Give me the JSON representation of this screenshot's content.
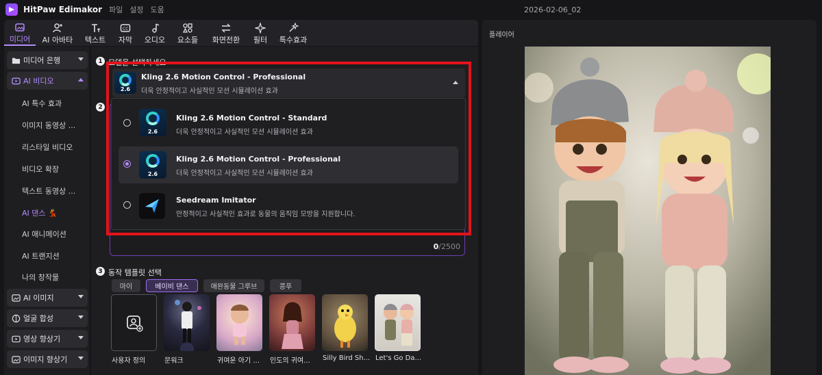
{
  "app": {
    "name": "HitPaw Edimakor",
    "project_title": "2026-02-06_02"
  },
  "menu": [
    "파일",
    "설정",
    "도움"
  ],
  "toolbar": [
    {
      "label": "미디어",
      "icon": "media-icon",
      "active": true
    },
    {
      "label": "AI 아바타",
      "icon": "ai-avatar-icon"
    },
    {
      "label": "텍스트",
      "icon": "text-icon"
    },
    {
      "label": "자막",
      "icon": "subtitle-icon"
    },
    {
      "label": "오디오",
      "icon": "audio-icon"
    },
    {
      "label": "요소들",
      "icon": "elements-icon"
    },
    {
      "label": "화면전환",
      "icon": "transition-icon"
    },
    {
      "label": "필터",
      "icon": "filter-icon"
    },
    {
      "label": "특수효과",
      "icon": "effects-icon"
    }
  ],
  "sidebar": {
    "groups": {
      "media_bank": "미디어 은행",
      "ai_video": "AI 비디오",
      "ai_image": "AI  이미지",
      "face_swap": "얼굴 합성",
      "video_enhancer": "영상 향상기",
      "image_enhancer": "이미지 향상기"
    },
    "ai_video_items": [
      "AI 특수 효과",
      "이미지 동영상 ...",
      "리스타일 비디오",
      "비디오 확장",
      "텍스트 동영상 ...",
      "AI 댄스 💃",
      "AI 애니메이션",
      "AI 트랜지션",
      "나의 창작물"
    ]
  },
  "steps": {
    "step1": {
      "num": "1",
      "label": "모델을 선택하세요"
    },
    "step2": {
      "num": "2"
    },
    "step3": {
      "num": "3",
      "label": "동작 템플릿 선택"
    }
  },
  "model_select": {
    "selected_title": "Kling 2.6 Motion Control - Professional",
    "selected_desc": "더욱 안정적이고 사실적인 모션 시뮬레이션 효과",
    "options": [
      {
        "title": "Kling 2.6 Motion Control - Standard",
        "desc": "더욱 안정적이고 사실적인 모션 시뮬레이션 효과",
        "selected": false
      },
      {
        "title": "Kling 2.6 Motion Control - Professional",
        "desc": "더욱 안정적이고 사실적인 모션 시뮬레이션 효과",
        "selected": true
      },
      {
        "title": "Seedream Imitator",
        "desc": "안정적이고 사실적인 효과로 동물의 움직임 모방을 지원합니다.",
        "selected": false
      }
    ],
    "version_badge": "2.6"
  },
  "prompt": {
    "count": "0",
    "max": "/2500"
  },
  "template_tabs": [
    {
      "label": "마이",
      "active": false
    },
    {
      "label": "베이비 댄스",
      "active": true
    },
    {
      "label": "애완동물 그루브",
      "active": false
    },
    {
      "label": "콩푸",
      "active": false
    }
  ],
  "templates": [
    "사용자 정의",
    "문워크",
    "귀여운 아기 ...",
    "인도의 귀여...",
    "Silly Bird Sh...",
    "Let's Go Da..."
  ],
  "player": {
    "title": "플레이어"
  },
  "colors": {
    "accent": "#b68cff",
    "highlight_red": "#e3131b",
    "bg": "#161618",
    "panel": "#1e1e21"
  }
}
